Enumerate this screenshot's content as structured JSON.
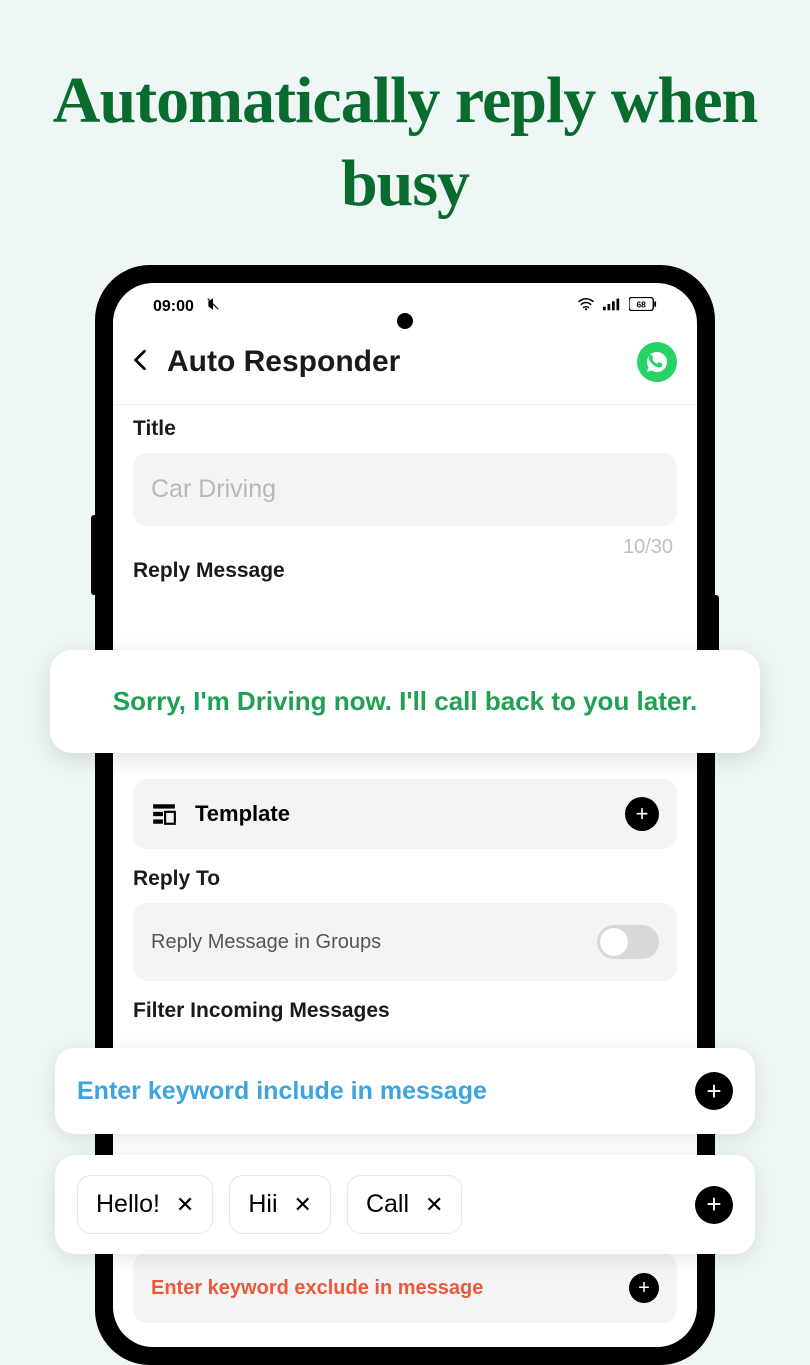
{
  "hero": {
    "title": "Automatically reply when busy"
  },
  "status": {
    "time": "09:00",
    "battery": "68"
  },
  "header": {
    "title": "Auto Responder"
  },
  "title_section": {
    "label": "Title",
    "placeholder": "Car Driving",
    "counter": "10/30"
  },
  "reply_section": {
    "label": "Reply Message",
    "message": "Sorry, I'm Driving now. I'll call back to you later."
  },
  "template": {
    "label": "Template"
  },
  "reply_to": {
    "label": "Reply To",
    "groups_label": "Reply Message in Groups"
  },
  "filter": {
    "label": "Filter Incoming Messages",
    "include_placeholder": "Enter keyword include in message",
    "exclude_placeholder": "Enter keyword exclude in message",
    "chips": [
      "Hello!",
      "Hii",
      "Call"
    ]
  }
}
